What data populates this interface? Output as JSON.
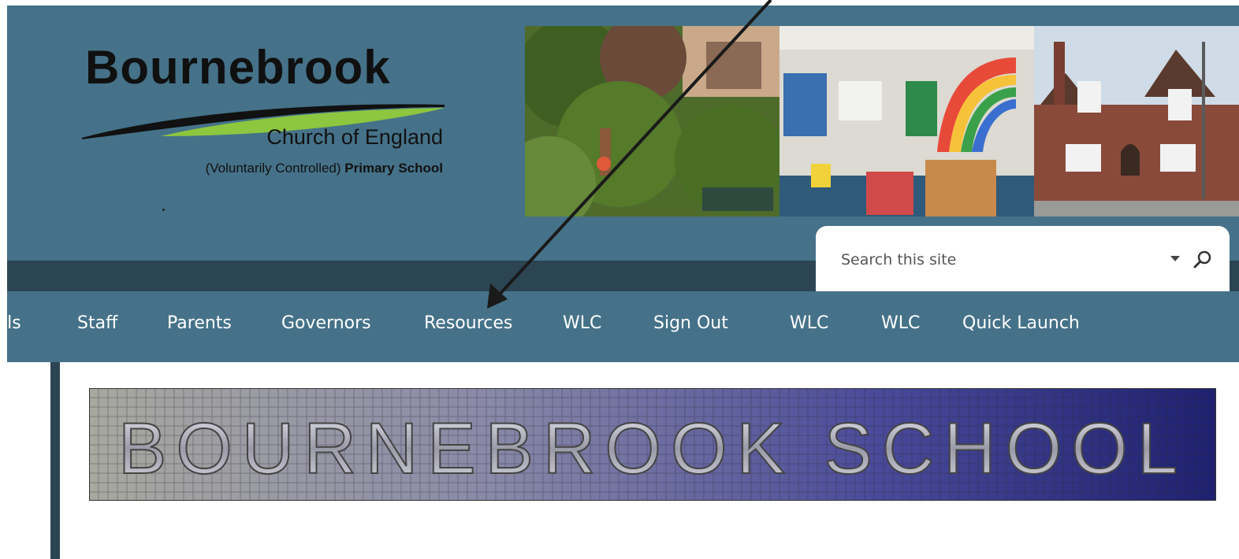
{
  "logo": {
    "title": "Bournebrook",
    "subtitle": "Church of England",
    "vc_text": "(Voluntarily Controlled)",
    "primary_text": "Primary School"
  },
  "header_photos": [
    "garden-photo",
    "classroom-photo",
    "school-building-photo"
  ],
  "search": {
    "placeholder": "Search this site",
    "dropdown_icon": "caret-down-icon",
    "search_icon": "magnifier-icon"
  },
  "nav": {
    "items": [
      {
        "label": "ils"
      },
      {
        "label": "Staff"
      },
      {
        "label": "Parents"
      },
      {
        "label": "Governors"
      },
      {
        "label": "Resources"
      },
      {
        "label": "WLC"
      },
      {
        "label": "Sign Out"
      },
      {
        "label": "WLC"
      },
      {
        "label": "WLC"
      },
      {
        "label": "Quick Launch"
      }
    ]
  },
  "banner": {
    "text": "BOURNEBROOK SCHOOL"
  },
  "colors": {
    "header_bg": "#457289",
    "dark_bar": "#2c4553",
    "nav_text": "#ffffff",
    "logo_swoosh": "#8dc63f"
  }
}
